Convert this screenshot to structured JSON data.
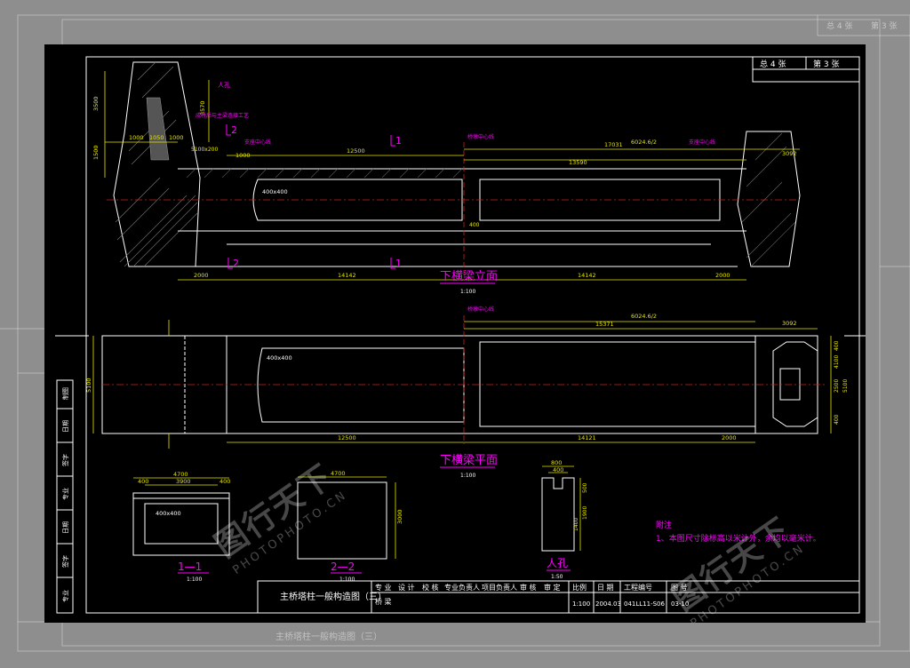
{
  "sheet": {
    "total_label": "总 4 张",
    "sheet_no_label": "第 3 张"
  },
  "elevation": {
    "title": "下横梁立面",
    "scale": "1:100",
    "dims_top": [
      "12500",
      "17031",
      "13590",
      "6024.6/2",
      "3092"
    ],
    "dims_bottom": [
      "2000",
      "14142",
      "14142",
      "2000"
    ],
    "dims_left": [
      "3500",
      "1500",
      "1000",
      "1050",
      "1000",
      "2000",
      "1000",
      "3570"
    ],
    "box_label": "400x400",
    "labels": {
      "person_hole": "人孔",
      "support_center_left": "支座中心线",
      "support_center_right": "支座中心线",
      "bridge_center": "桥墩中心线",
      "anchor_note": "成桥后与主梁连接工艺",
      "size_label": "5100x200",
      "mid_dim": "400"
    },
    "sections": {
      "sec1_top": "1",
      "sec1_bottom": "1",
      "sec2_top": "2",
      "sec2_bottom": "2"
    }
  },
  "plan": {
    "title": "下横梁平面",
    "scale": "1:100",
    "dims_top": [
      "15371",
      "6024.6/2",
      "3092"
    ],
    "dims_bottom": [
      "12500",
      "14121",
      "2000"
    ],
    "left_dim": "5100",
    "right_dims": [
      "400",
      "4100",
      "2500",
      "5100",
      "400"
    ],
    "box_label": "400x400",
    "bridge_center": "桥墩中心线"
  },
  "section11": {
    "title": "1—1",
    "scale": "1:100",
    "dims": [
      "4700",
      "3900",
      "400",
      "400"
    ],
    "box_label": "400x400"
  },
  "section22": {
    "title": "2—2",
    "scale": "1:100",
    "dims": [
      "4700",
      "3000"
    ]
  },
  "manhole": {
    "title": "人孔",
    "scale": "1:50",
    "dims": [
      "800",
      "400",
      "500",
      "1900",
      "1400"
    ]
  },
  "notes": {
    "heading": "附注",
    "line1": "1、本图尺寸除标高以米计外，余均以毫米计。"
  },
  "titleblock": {
    "drawing_title": "主桥塔柱一般构造图（三）",
    "row1": [
      "专 业",
      "设 计",
      "校 核",
      "专业负责人",
      "项目负责人",
      "审 核",
      "审 定",
      "比例",
      "日 期",
      "工程编号",
      "图 号"
    ],
    "row2": [
      "桥 梁"
    ],
    "scale_value": "1:100",
    "date_value": "2004.03",
    "project_no": "041LL11-S06",
    "drawing_no": "03-10"
  },
  "left_strip": [
    "制图",
    "日期",
    "签字",
    "专业",
    "日期",
    "签字",
    "专业"
  ],
  "watermark": {
    "text": "图行天下",
    "sub": "PHOTOPHOTO.CN"
  },
  "colors": {
    "yellow": "#e6e600",
    "white": "#ffffff",
    "magenta": "#ff00ff",
    "red": "#cc2020",
    "cyan": "#00e0e0"
  }
}
